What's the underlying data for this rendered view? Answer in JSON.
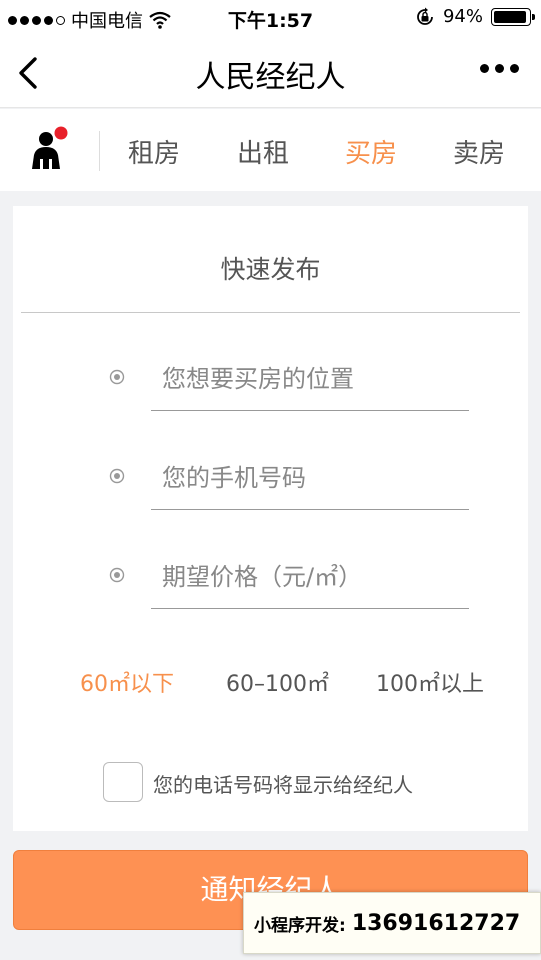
{
  "status_bar": {
    "carrier": "中国电信",
    "time": "下午1:57",
    "battery_percent": "94%",
    "battery_level": 0.94,
    "icons": [
      "signal-dots",
      "wifi-icon",
      "rotation-lock-icon",
      "battery-icon"
    ]
  },
  "nav": {
    "title": "人民经纪人",
    "back_icon": "chevron-left-icon",
    "more_icon": "more-dots-icon"
  },
  "tabs": {
    "avatar_icon": "person-icon",
    "items": [
      {
        "label": "租房",
        "active": false
      },
      {
        "label": "出租",
        "active": false
      },
      {
        "label": "买房",
        "active": true
      },
      {
        "label": "卖房",
        "active": false
      }
    ]
  },
  "form": {
    "title": "快速发布",
    "fields": [
      {
        "placeholder": "您想要买房的位置",
        "value": ""
      },
      {
        "placeholder": "您的手机号码",
        "value": ""
      },
      {
        "placeholder": "期望价格（元/㎡）",
        "value": ""
      }
    ],
    "area_options": [
      {
        "label": "60㎡以下",
        "active": true
      },
      {
        "label": "60–100㎡",
        "active": false
      },
      {
        "label": "100㎡以上",
        "active": false
      }
    ],
    "consent_label": "您的电话号码将显示给经纪人",
    "consent_checked": false
  },
  "submit": {
    "label": "通知经纪人"
  },
  "overlay": {
    "label": "小程序开发:",
    "number": "13691612727"
  },
  "colors": {
    "accent": "#f7904c",
    "button": "#fe9153",
    "background": "#f1f2f4",
    "badge": "#e8202a"
  }
}
